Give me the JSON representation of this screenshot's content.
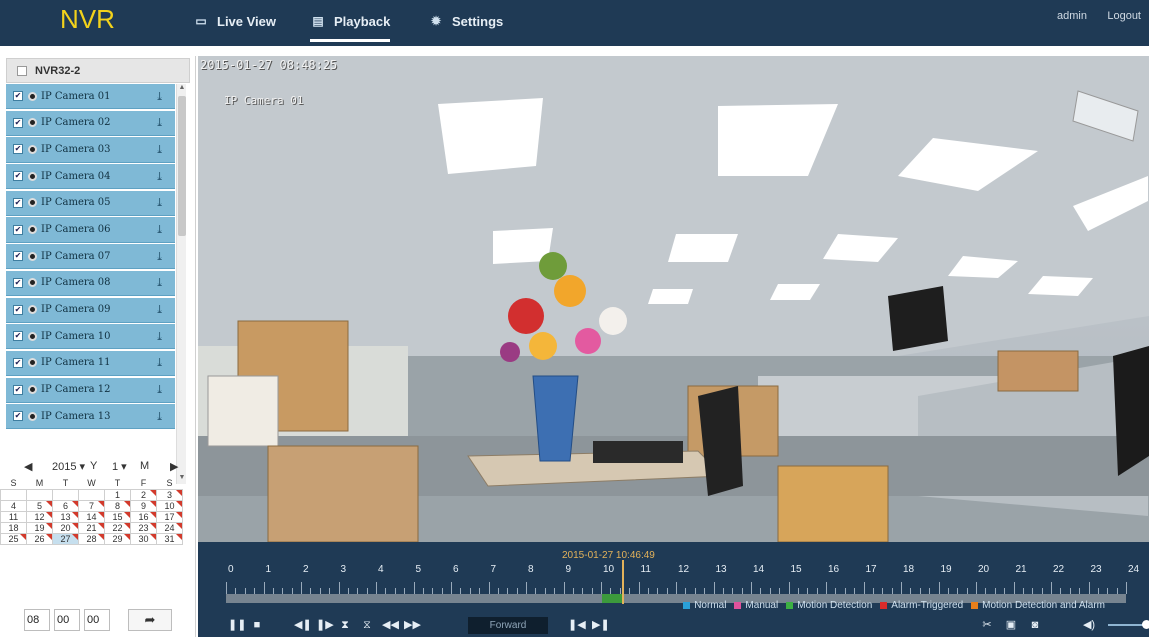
{
  "app": {
    "logo": "NVR"
  },
  "nav": {
    "live_view": "Live View",
    "playback": "Playback",
    "settings": "Settings"
  },
  "user": {
    "name": "admin",
    "logout": "Logout"
  },
  "device": {
    "name": "NVR32-2"
  },
  "cameras": [
    {
      "label": "IP Camera 01"
    },
    {
      "label": "IP Camera 02"
    },
    {
      "label": "IP Camera 03"
    },
    {
      "label": "IP Camera 04"
    },
    {
      "label": "IP Camera 05"
    },
    {
      "label": "IP Camera 06"
    },
    {
      "label": "IP Camera 07"
    },
    {
      "label": "IP Camera 08"
    },
    {
      "label": "IP Camera 09"
    },
    {
      "label": "IP Camera 10"
    },
    {
      "label": "IP Camera 11"
    },
    {
      "label": "IP Camera 12"
    },
    {
      "label": "IP Camera 13"
    }
  ],
  "calendar": {
    "year": "2015",
    "year_unit": "Y",
    "month": "1",
    "month_unit": "M",
    "weekdays": [
      "S",
      "M",
      "T",
      "W",
      "T",
      "F",
      "S"
    ],
    "weeks": [
      [
        "",
        "",
        "",
        "",
        "1",
        "2",
        "3"
      ],
      [
        "4",
        "5",
        "6",
        "7",
        "8",
        "9",
        "10"
      ],
      [
        "11",
        "12",
        "13",
        "14",
        "15",
        "16",
        "17"
      ],
      [
        "18",
        "19",
        "20",
        "21",
        "22",
        "23",
        "24"
      ],
      [
        "25",
        "26",
        "27",
        "28",
        "29",
        "30",
        "31"
      ]
    ],
    "days_with_records": [
      "2",
      "3",
      "5",
      "6",
      "7",
      "8",
      "9",
      "10",
      "12",
      "13",
      "14",
      "15",
      "16",
      "17",
      "19",
      "20",
      "21",
      "22",
      "23",
      "24",
      "25",
      "26",
      "27",
      "28",
      "29",
      "30",
      "31"
    ],
    "selected_day": "27"
  },
  "time_input": {
    "hour": "08",
    "minute": "00",
    "second": "00"
  },
  "video": {
    "osd_time": "2015-01-27 08:48:25",
    "osd_camera": "IP Camera 01"
  },
  "timeline": {
    "current_label": "2015-01-27 10:46:49",
    "hours": [
      "0",
      "1",
      "2",
      "3",
      "4",
      "5",
      "6",
      "7",
      "8",
      "9",
      "10",
      "11",
      "12",
      "13",
      "14",
      "15",
      "16",
      "17",
      "18",
      "19",
      "20",
      "21",
      "22",
      "23",
      "24"
    ],
    "legend": [
      {
        "label": "Normal",
        "color": "#2aa0d8"
      },
      {
        "label": "Manual",
        "color": "#e0529c"
      },
      {
        "label": "Motion Detection",
        "color": "#3cb043"
      },
      {
        "label": "Alarm-Triggered",
        "color": "#d92b2b"
      },
      {
        "label": "Motion Detection and Alarm",
        "color": "#e87f1c"
      }
    ]
  },
  "controls": {
    "speed_label": "Forward"
  },
  "colors": {
    "topbar": "#1f3a55",
    "accent": "#f2d21b",
    "camera_row": "#7fb9d6"
  }
}
